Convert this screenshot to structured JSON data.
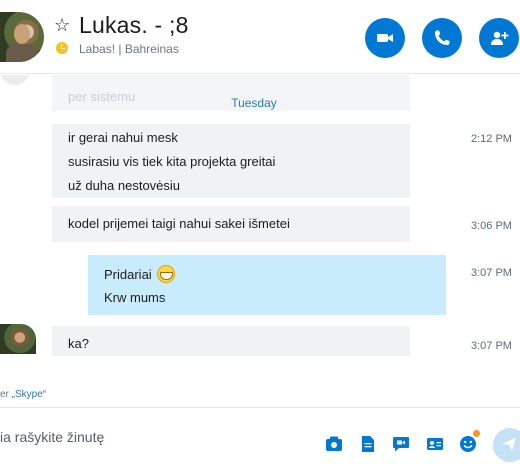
{
  "header": {
    "title": "Lukas. - ;8",
    "subtitle": "Labas! | Bahreinas",
    "accent": "#0078d4"
  },
  "chat": {
    "ghost_text": "per sistemu",
    "day_label": "Tuesday",
    "messages": [
      {
        "lines": [
          "ir gerai nahui mesk",
          "susirasiu vis tiek kita projekta greitai",
          "už duha nestovėsiu"
        ],
        "time": "2:12 PM"
      },
      {
        "lines": [
          "kodel prijemei taigi nahui sakei išmetei"
        ],
        "time": "3:06 PM"
      },
      {
        "lines": [
          "Pridariai",
          "Krw mums"
        ],
        "time": "3:07 PM",
        "emoji": "grinning-face-icon"
      },
      {
        "lines": [
          "ka?"
        ],
        "time": "3:07 PM"
      }
    ]
  },
  "ad": {
    "prefix": "er ",
    "link": "„Skype“"
  },
  "compose": {
    "placeholder": "ia rašykite žinutę",
    "tools": [
      "media-gallery-icon",
      "file-icon",
      "video-message-icon",
      "contact-card-icon",
      "emoticon-icon"
    ],
    "send_icon": "send-icon"
  }
}
